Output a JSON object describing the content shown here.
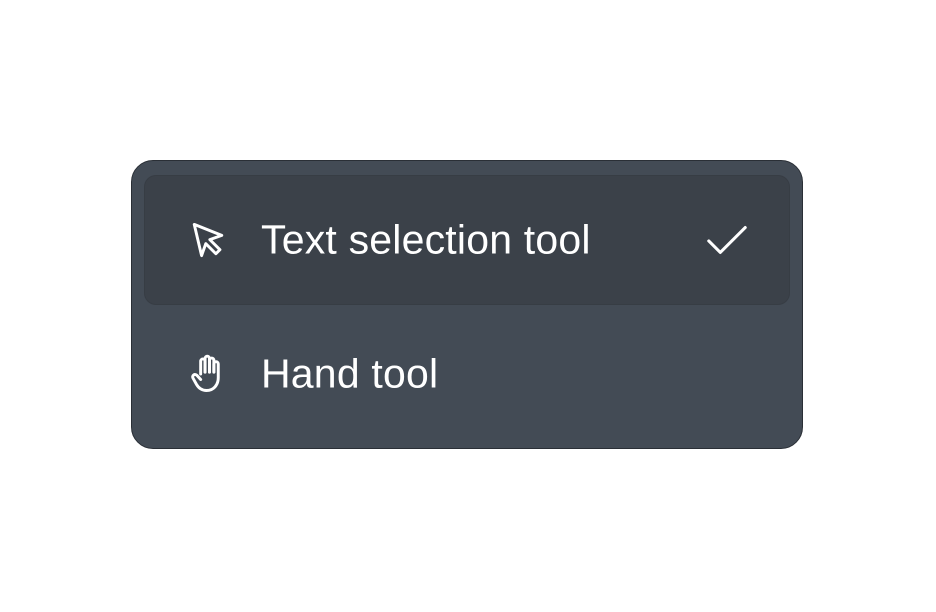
{
  "menu": {
    "items": [
      {
        "label": "Text selection tool",
        "icon": "cursor-arrow-icon",
        "selected": true,
        "trailing_icon": "checkmark-icon"
      },
      {
        "label": "Hand tool",
        "icon": "hand-icon",
        "selected": false
      }
    ]
  },
  "colors": {
    "menu_background": "#434b55",
    "menu_border": "#2a2f36",
    "selected_item_background": "#3b4149",
    "text": "#ffffff",
    "page_background": "#ffffff"
  }
}
